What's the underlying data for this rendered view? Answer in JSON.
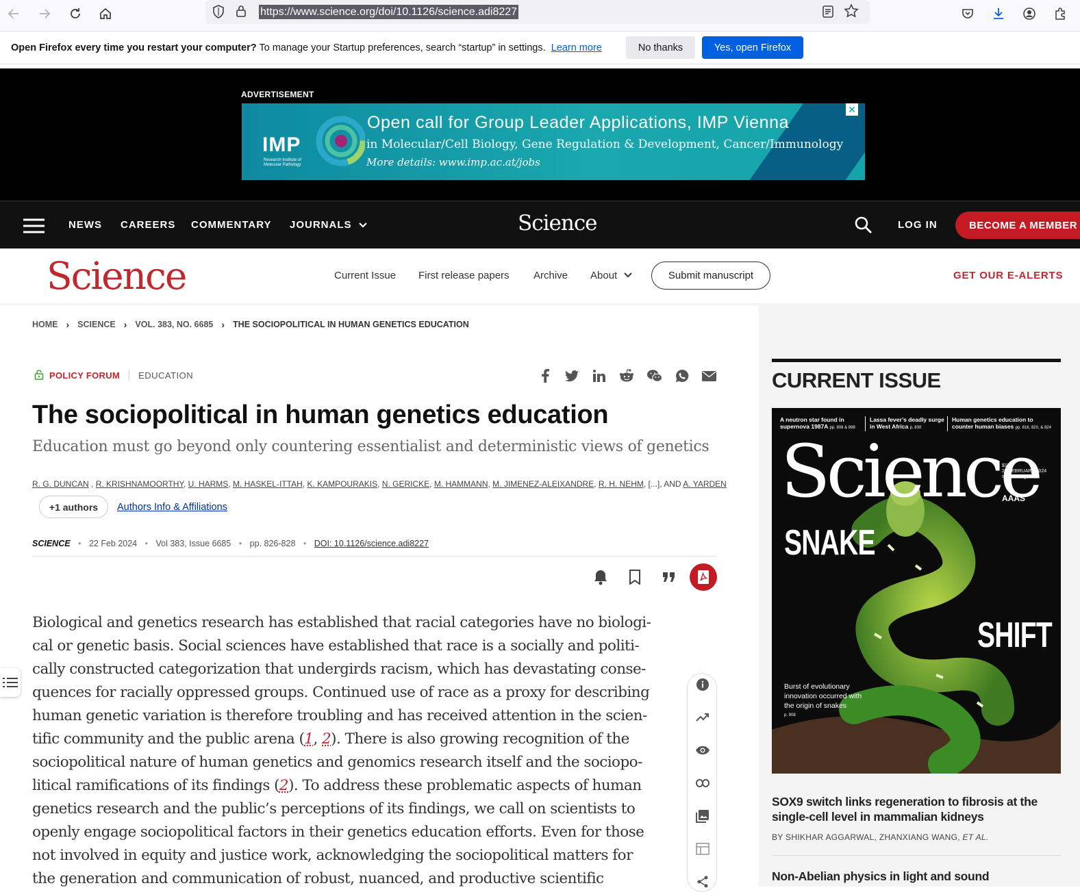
{
  "browser": {
    "url": "https://www.science.org/doi/10.1126/science.adi8227"
  },
  "notification": {
    "bold": "Open Firefox every time you restart your computer?",
    "text": "To manage your Startup preferences, search “startup” in settings.",
    "link": "Learn more",
    "no_button": "No thanks",
    "yes_button": "Yes, open Firefox"
  },
  "ad": {
    "label": "ADVERTISEMENT",
    "brand": "IMP",
    "brand_sub": "Research Institute of Molecular Pathology",
    "headline": "Open call for Group Leader Applications, IMP Vienna",
    "line2": "in Molecular/Cell Biology, Gene Regulation & Development, Cancer/Immunology",
    "line3": "More details: www.imp.ac.at/jobs",
    "close": "✕"
  },
  "topnav": {
    "items": [
      "NEWS",
      "CAREERS",
      "COMMENTARY",
      "JOURNALS"
    ],
    "logo": "Science",
    "login": "LOG IN",
    "member": "BECOME A MEMBER"
  },
  "subnav": {
    "logo": "Science",
    "items": [
      "Current Issue",
      "First release papers",
      "Archive",
      "About"
    ],
    "submit": "Submit manuscript",
    "alerts": "GET OUR E-ALERTS"
  },
  "breadcrumb": [
    "HOME",
    "SCIENCE",
    "VOL. 383, NO. 6685",
    "THE SOCIOPOLITICAL IN HUMAN GENETICS EDUCATION"
  ],
  "article": {
    "tag_primary": "POLICY FORUM",
    "tag_secondary": "EDUCATION",
    "title": "The sociopolitical in human genetics education",
    "subtitle": "Education must go beyond only countering essentialist and deterministic views of genetics",
    "authors": [
      "R. G. DUNCAN",
      "R. KRISHNAMOORTHY",
      "U. HARMS",
      "M. HASKEL-ITTAH",
      "K. KAMPOURAKIS",
      "N. GERICKE",
      "M. HAMMANN",
      "M. JIMENEZ-ALEIXANDRE",
      "R. H. NEHM"
    ],
    "authors_ellipsis": "[...]",
    "authors_and": "AND",
    "authors_last": "A. YARDEN",
    "more_authors": "+1 authors",
    "affiliations": "Authors Info & Affiliations",
    "journal": "SCIENCE",
    "date": "22 Feb 2024",
    "volume": "Vol 383, Issue 6685",
    "pages": "pp. 826-828",
    "doi": "DOI: 10.1126/science.adi8227",
    "body_lines": [
      "Biological and genetics research has established that racial categories have no biologi-",
      "cal or genetic basis. Social sciences have established that race is a socially and politi-",
      "cally constructed categorization that undergirds racism, which has devastating conse-",
      "quences for racially oppressed groups. Continued use of race as a proxy for describing",
      "human genetic variation is therefore troubling and has received attention in the scien-"
    ],
    "line6_a": "tific community and the public arena (",
    "ref1": "1",
    "ref_comma": ", ",
    "ref2": "2",
    "line6_b": "). There is also growing recognition of the",
    "line7": "sociopolitical nature of human genetics and genomics research itself and the sociopo-",
    "line8_a": "litical ramifications of its findings (",
    "ref3": "2",
    "line8_b": "). To address these problematic aspects of human",
    "body_lines2": [
      "genetics research and the public’s perceptions of its findings, we call on scientists to",
      "openly engage sociopolitical factors in their genetics education efforts. Even for those",
      "not involved in equity and justice work, acknowledging the sociopolitical matters for",
      "the generation and communication of robust, nuanced, and productive scientific"
    ]
  },
  "current_issue": {
    "heading": "CURRENT ISSUE",
    "cover": {
      "teaser1": "A neutron star found in supernova 1987A",
      "teaser1_pages": "pp. 808 & 898",
      "teaser2": "Lassa fever’s deadly surge in West Africa",
      "teaser2_pages": "p. 830",
      "teaser3": "Human genetics education to counter human biases",
      "teaser3_pages": "pp. 816, 820, & 824",
      "logo": "Science",
      "price": "$15",
      "date": "23 FEBRUARY 2024",
      "site": "science.org",
      "aaas": "AAAS",
      "word1": "SNAKE",
      "word2": "SHIFT",
      "burst": "Burst of evolutionary innovation occurred with the origin of snakes",
      "burst_page": "p. 908"
    },
    "article1_title": "SOX9 switch links regeneration to fibrosis at the single-cell level in mammalian kidneys",
    "article1_by": "BY SHIKHAR AGGARWAL,",
    "article1_by2": "ZHANXIANG WANG,",
    "article1_etal": "ET AL.",
    "article2_title": "Non-Abelian physics in light and sound"
  },
  "colors": {
    "science_red": "#c1272d",
    "firefox_blue": "#0061e0",
    "nav_black": "#111111"
  }
}
